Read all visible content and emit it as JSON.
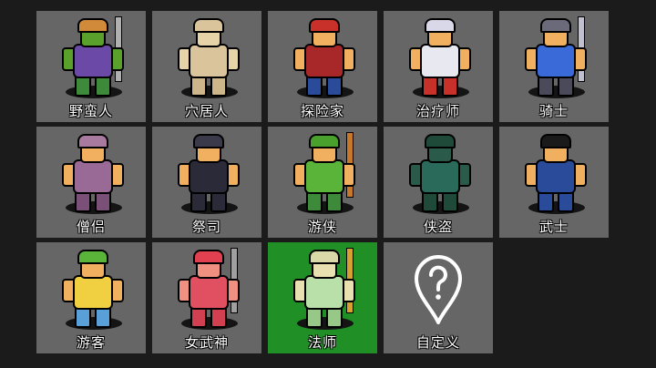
{
  "classes": [
    {
      "id": "barbarian",
      "label": "野蛮人",
      "selected": false,
      "colors": {
        "skin": "#5aa02c",
        "hat": "#d08a3a",
        "body": "#6a4aa6",
        "legs": "#3d8a3a",
        "weapon": "#b0b0b0"
      }
    },
    {
      "id": "caveman",
      "label": "穴居人",
      "selected": false,
      "colors": {
        "skin": "#e6d3a8",
        "hat": "#d9c49b",
        "body": "#d9c49b",
        "legs": "#cdb68a",
        "weapon": "#d9c49b"
      }
    },
    {
      "id": "explorer",
      "label": "探险家",
      "selected": false,
      "colors": {
        "skin": "#f0b060",
        "hat": "#c8302a",
        "body": "#a8282a",
        "legs": "#2a4a9a",
        "weapon": "#c8302a"
      }
    },
    {
      "id": "healer",
      "label": "治疗师",
      "selected": false,
      "colors": {
        "skin": "#f0b060",
        "hat": "#d8d8e8",
        "body": "#e8e8f0",
        "legs": "#c8302a",
        "weapon": "#c8302a"
      }
    },
    {
      "id": "knight",
      "label": "骑士",
      "selected": false,
      "colors": {
        "skin": "#f0b060",
        "hat": "#6a6a7a",
        "body": "#3a6ad8",
        "legs": "#4a4a5a",
        "weapon": "#c0c0d0"
      }
    },
    {
      "id": "monk",
      "label": "僧侣",
      "selected": false,
      "colors": {
        "skin": "#f0b060",
        "hat": "#a87aa0",
        "body": "#9a6a96",
        "legs": "#7a5078",
        "weapon": "#9a6a96"
      }
    },
    {
      "id": "priest",
      "label": "祭司",
      "selected": false,
      "colors": {
        "skin": "#f0b060",
        "hat": "#3a3a4a",
        "body": "#2a2a38",
        "legs": "#2a2a38",
        "weapon": "#d08a3a"
      }
    },
    {
      "id": "ranger",
      "label": "游侠",
      "selected": false,
      "colors": {
        "skin": "#f0b060",
        "hat": "#4aa02c",
        "body": "#5ab43a",
        "legs": "#3d8a3a",
        "weapon": "#c8782a"
      }
    },
    {
      "id": "thief",
      "label": "侠盗",
      "selected": false,
      "colors": {
        "skin": "#2a5a4a",
        "hat": "#1f4a3a",
        "body": "#2a6a5a",
        "legs": "#1f4a3a",
        "weapon": "#c0c0c0"
      }
    },
    {
      "id": "samurai",
      "label": "武士",
      "selected": false,
      "colors": {
        "skin": "#f0b060",
        "hat": "#1a1a1a",
        "body": "#2a4a9a",
        "legs": "#2a4a9a",
        "weapon": "#d0d0d0"
      }
    },
    {
      "id": "wanderer",
      "label": "游客",
      "selected": false,
      "colors": {
        "skin": "#f0b060",
        "hat": "#5ab43a",
        "body": "#f0d040",
        "legs": "#5aa0d8",
        "weapon": "#c8782a"
      }
    },
    {
      "id": "valkyrie",
      "label": "女武神",
      "selected": false,
      "colors": {
        "skin": "#f09080",
        "hat": "#e04050",
        "body": "#e05060",
        "legs": "#d04050",
        "weapon": "#a0a0a0"
      }
    },
    {
      "id": "wizard",
      "label": "法师",
      "selected": true,
      "colors": {
        "skin": "#e8e0b0",
        "hat": "#d8d8a8",
        "body": "#b8e0a8",
        "legs": "#98c888",
        "weapon": "#d8a030"
      }
    },
    {
      "id": "custom",
      "label": "自定义",
      "selected": false,
      "icon": "location-pin-question-icon"
    }
  ]
}
